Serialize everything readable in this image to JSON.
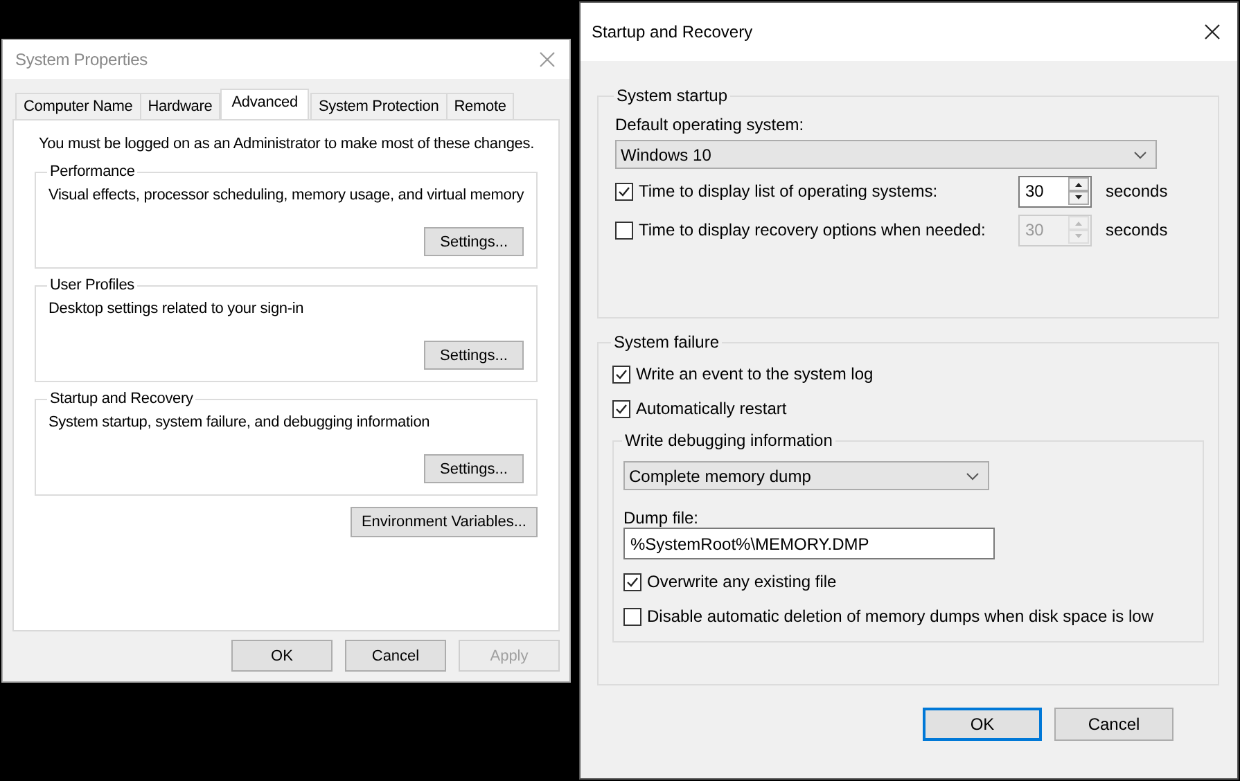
{
  "system_properties": {
    "title": "System Properties",
    "tabs": [
      {
        "label": "Computer Name",
        "selected": false
      },
      {
        "label": "Hardware",
        "selected": false
      },
      {
        "label": "Advanced",
        "selected": true
      },
      {
        "label": "System Protection",
        "selected": false
      },
      {
        "label": "Remote",
        "selected": false
      }
    ],
    "notice": "You must be logged on as an Administrator to make most of these changes.",
    "groups": [
      {
        "title": "Performance",
        "description": "Visual effects, processor scheduling, memory usage, and virtual memory",
        "button": "Settings..."
      },
      {
        "title": "User Profiles",
        "description": "Desktop settings related to your sign-in",
        "button": "Settings..."
      },
      {
        "title": "Startup and Recovery",
        "description": "System startup, system failure, and debugging information",
        "button": "Settings..."
      }
    ],
    "environment_button": "Environment Variables...",
    "buttons": [
      {
        "label": "OK",
        "disabled": false
      },
      {
        "label": "Cancel",
        "disabled": false
      },
      {
        "label": "Apply",
        "disabled": true
      }
    ]
  },
  "startup_and_recovery": {
    "title": "Startup and Recovery",
    "system_startup": {
      "title": "System startup",
      "default_os_label": "Default operating system:",
      "default_os": "Windows 10",
      "options": [
        {
          "label": "Time to display list of operating systems:",
          "checked": true,
          "value": "30",
          "disabled": false,
          "unit": "seconds"
        },
        {
          "label": "Time to display recovery options when needed:",
          "checked": false,
          "value": "30",
          "disabled": true,
          "unit": "seconds"
        }
      ]
    },
    "system_failure": {
      "title": "System failure",
      "options": [
        {
          "label": "Write an event to the system log",
          "checked": true
        },
        {
          "label": "Automatically restart",
          "checked": true
        }
      ],
      "debugging": {
        "title": "Write debugging information",
        "type": "Complete memory dump",
        "dump_file_label": "Dump file:",
        "dump_file": "%SystemRoot%\\MEMORY.DMP",
        "options": [
          {
            "label": "Overwrite any existing file",
            "checked": true
          },
          {
            "label": "Disable automatic deletion of memory dumps when disk space is low",
            "checked": false
          }
        ]
      }
    },
    "buttons": [
      {
        "label": "OK",
        "default": true
      },
      {
        "label": "Cancel",
        "default": false
      }
    ]
  }
}
